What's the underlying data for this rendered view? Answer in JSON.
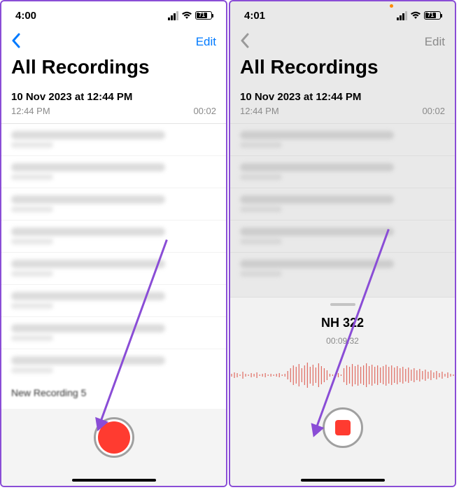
{
  "left": {
    "status": {
      "time": "4:00",
      "battery": "71"
    },
    "nav": {
      "edit": "Edit"
    },
    "title": "All Recordings",
    "item0": {
      "title": "10 Nov 2023 at 12:44 PM",
      "time": "12:44 PM",
      "dur": "00:02"
    },
    "lastRowLabel": "New Recording 5"
  },
  "right": {
    "status": {
      "time": "4:01",
      "battery": "71"
    },
    "nav": {
      "edit": "Edit"
    },
    "title": "All Recordings",
    "item0": {
      "title": "10 Nov 2023 at 12:44 PM",
      "time": "12:44 PM",
      "dur": "00:02"
    },
    "recording": {
      "name": "NH 322",
      "elapsed": "00:09.32"
    }
  }
}
